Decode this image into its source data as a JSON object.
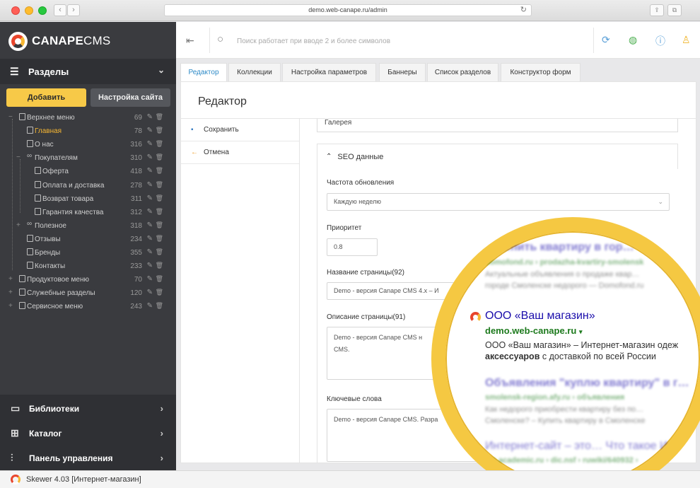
{
  "browser": {
    "url": "demo.web-canape.ru/admin",
    "back_icon": "‹",
    "forward_icon": "›",
    "reload_icon": "↻",
    "share_icon": "⇪",
    "tabs_icon": "⧉"
  },
  "sidebar": {
    "logo_text_bold": "CANAPE",
    "logo_text_light": "CMS",
    "section_title": "Разделы",
    "add_button": "Добавить",
    "settings_button": "Настройка сайта",
    "tree": [
      {
        "label": "Верхнее меню",
        "count": "69",
        "expander": "−",
        "type": "page"
      },
      {
        "label": "Главная",
        "count": "78",
        "expander": "",
        "type": "page",
        "active": true
      },
      {
        "label": "О нас",
        "count": "316",
        "expander": "",
        "type": "page"
      },
      {
        "label": "Покупателям",
        "count": "310",
        "expander": "−",
        "type": "link"
      },
      {
        "label": "Оферта",
        "count": "418",
        "expander": "",
        "type": "page"
      },
      {
        "label": "Оплата и доставка",
        "count": "278",
        "expander": "",
        "type": "page"
      },
      {
        "label": "Возврат товара",
        "count": "311",
        "expander": "",
        "type": "page"
      },
      {
        "label": "Гарантия качества",
        "count": "312",
        "expander": "",
        "type": "page"
      },
      {
        "label": "Полезное",
        "count": "318",
        "expander": "+",
        "type": "link"
      },
      {
        "label": "Отзывы",
        "count": "234",
        "expander": "",
        "type": "page"
      },
      {
        "label": "Бренды",
        "count": "355",
        "expander": "",
        "type": "page"
      },
      {
        "label": "Контакты",
        "count": "233",
        "expander": "",
        "type": "page"
      },
      {
        "label": "Продуктовое меню",
        "count": "70",
        "expander": "+",
        "type": "page"
      },
      {
        "label": "Служебные разделы",
        "count": "120",
        "expander": "+",
        "type": "page"
      },
      {
        "label": "Сервисное меню",
        "count": "243",
        "expander": "+",
        "type": "page"
      }
    ],
    "bottom_menu": [
      {
        "label": "Библиотеки",
        "icon": "📖"
      },
      {
        "label": "Каталог",
        "icon": "▦"
      },
      {
        "label": "Панель управления",
        "icon": "⚙"
      }
    ]
  },
  "toolbar": {
    "search_placeholder": "Поиск работает при вводе 2 и более символов",
    "icons": [
      "refresh-icon",
      "globe-icon",
      "help-icon",
      "user-icon"
    ]
  },
  "tabs": [
    {
      "label": "Редактор",
      "active": true
    },
    {
      "label": "Коллекции"
    },
    {
      "label": "Настройка параметров"
    },
    {
      "label": "Баннеры"
    },
    {
      "label": "Список разделов"
    },
    {
      "label": "Конструктор форм"
    }
  ],
  "editor": {
    "title": "Редактор",
    "save_label": "Сохранить",
    "cancel_label": "Отмена",
    "gallery_value": "Галерея",
    "seo_header": "SEO данные",
    "fields": {
      "freq_label": "Частота обновления",
      "freq_value": "Каждую неделю",
      "priority_label": "Приоритет",
      "priority_value": "0.8",
      "page_name_label": "Название страницы(92)",
      "page_name_value": "Demo - версия Canape CMS 4.x – И",
      "page_desc_label": "Описание страницы(91)",
      "page_desc_value": "Demo - версия Canape CMS н\nCMS.",
      "keywords_label": "Ключевые слова",
      "keywords_value": "Demo - версия Canape CMS. Разра"
    }
  },
  "magnifier": {
    "top_blur_1": "…пить квартиру в гор…",
    "top_blur_2": "domofond.ru › prodazha-kvartiry-smolensk",
    "top_blur_3": "Актуальные объявления о продаже квар…",
    "top_blur_4": "городе Смоленске недорого — Domofond.ru",
    "result_title": "ООО «Ваш магазин»",
    "result_url": "demo.web-canape.ru",
    "result_url_arrow": "▾",
    "result_desc_1": "ООО «Ваш магазин» – Интернет-магазин одеж",
    "result_desc_2_bold": "аксессуаров",
    "result_desc_2_rest": " с доставкой по всей России",
    "bottom_blur_1": "Объявления \"куплю квартиру\" в г…",
    "bottom_blur_2": "smolensk-region.afy.ru › объявления",
    "bottom_blur_3": "Как недорого приобрести квартиру без по…",
    "bottom_blur_4": "Смоленске? – Купить квартиру в Смоленске",
    "bottom_blur_5": "Интернет-сайт – это… Что такое И…",
    "bottom_blur_6": "dic.academic.ru › dic.nsf › ruwiki/640932 ›"
  },
  "status": {
    "text": "Skewer 4.03 [Интернет-магазин]"
  }
}
